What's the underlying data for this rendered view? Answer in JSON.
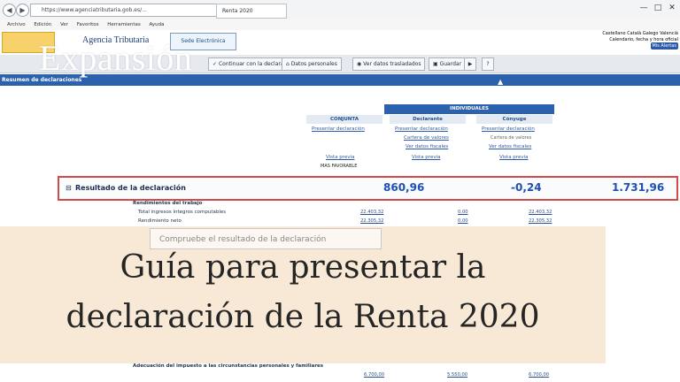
{
  "browser": {
    "address": "https://www.agenciatributaria.gob.es/...",
    "tab_title": "Renta 2020",
    "menu": [
      "Archivo",
      "Edición",
      "Ver",
      "Favoritos",
      "Herramientas",
      "Ayuda"
    ]
  },
  "header": {
    "agency": "Agencia Tributaria",
    "sede": "Sede Electrónica",
    "links": [
      "Castellano",
      "Català",
      "Galego",
      "Valencià"
    ],
    "calendar": "Calendario, fecha y hora oficial",
    "alerts": "Mis Alertas"
  },
  "toolbar": {
    "buttons": [
      "Continuar con la declaración",
      "Datos personales",
      "Ver datos trasladados",
      "Guardar"
    ]
  },
  "bar": {
    "title": "Resumen de declaraciones"
  },
  "columns": {
    "individuales": "INDIVIDUALES",
    "conjunta": "CONJUNTA",
    "declarante": "Declarante",
    "conyuge": "Cónyuge"
  },
  "links": {
    "presentar": "Presentar declaración",
    "cartera": "Cartera de valores",
    "datos_fiscales": "Ver datos fiscales",
    "vista_previa": "Vista previa",
    "mas_favorable": "MAS FAVORABLE"
  },
  "result": {
    "label": "Resultado de la declaración",
    "conjunta": "860,96",
    "declarante": "-0,24",
    "conyuge": "1.731,96"
  },
  "sections": {
    "rendimientos": "Rendimientos del trabajo",
    "total": "Total ingresos íntegros computables",
    "neto": "Rendimiento neto",
    "adecuacion": "Adecuación del impuesto a las circunstancias personales y familiares"
  },
  "values": {
    "a": "22.403,32",
    "b": "0,00",
    "c": "22.305,32",
    "d": "6.700,00",
    "e": "5.550,00"
  },
  "tooltip": "Compruebe el resultado de la declaración",
  "overlay": {
    "line1": "Guía para presentar la",
    "line2": "declaración de la Renta 2020"
  },
  "watermark": "Expansión"
}
